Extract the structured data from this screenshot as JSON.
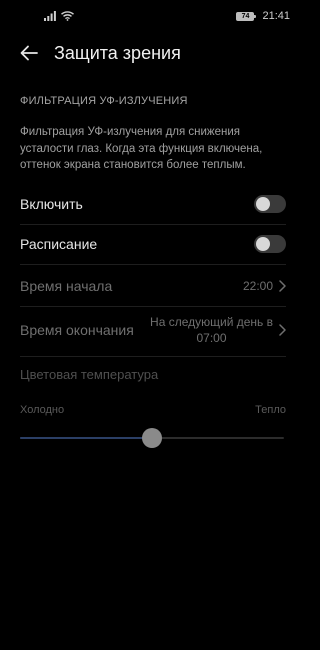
{
  "status_bar": {
    "battery": "74",
    "time": "21:41"
  },
  "header": {
    "title": "Защита зрения",
    "back_icon": "arrow-left-icon"
  },
  "section": {
    "title": "ФИЛЬТРАЦИЯ УФ-ИЗЛУЧЕНИЯ",
    "description": "Фильтрация УФ-излучения для снижения усталости глаз. Когда эта функция включена, оттенок экрана становится более теплым."
  },
  "settings": {
    "enable": {
      "label": "Включить",
      "on": false
    },
    "schedule": {
      "label": "Расписание",
      "on": false
    },
    "start_time": {
      "label": "Время начала",
      "value": "22:00"
    },
    "end_time": {
      "label": "Время окончания",
      "value_line1": "На следующий день в",
      "value_line2": "07:00"
    },
    "color_temperature": {
      "label": "Цветовая температура",
      "cold_label": "Холодно",
      "warm_label": "Тепло",
      "level": 0.5
    }
  },
  "colors": {
    "background": "#000000",
    "toggle_off": "#3a3a3a",
    "slider_fill": "#2b3f66"
  }
}
